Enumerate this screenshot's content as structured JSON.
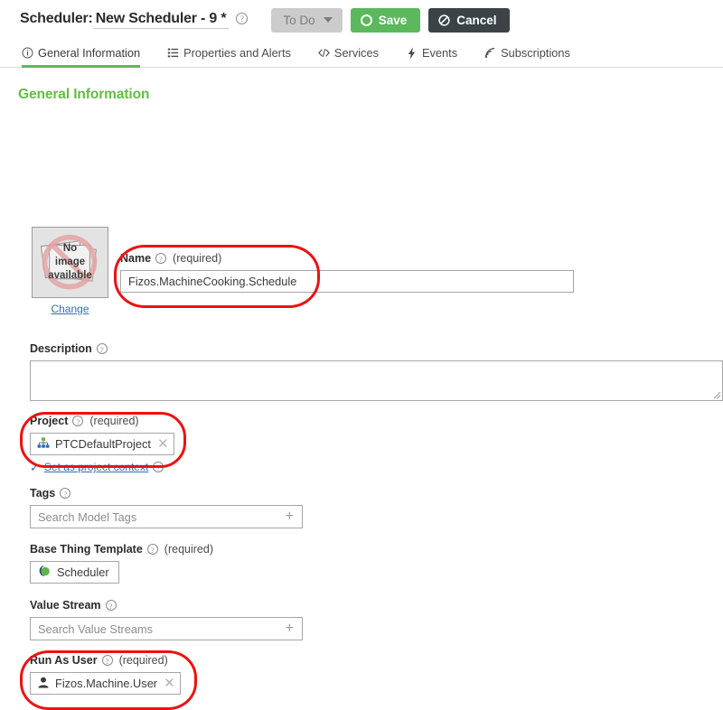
{
  "header": {
    "title_prefix": "Scheduler:",
    "title_name": "New Scheduler - 9 *",
    "help_glyph": "?",
    "status_button": "To Do",
    "save_button": "Save",
    "cancel_button": "Cancel",
    "save_color": "#5cb85c",
    "cancel_color": "#3b4346",
    "status_color": "#cccccc"
  },
  "tabs": [
    {
      "label": "General Information",
      "icon": "info-circle-icon",
      "active": true
    },
    {
      "label": "Properties and Alerts",
      "icon": "list-icon",
      "active": false
    },
    {
      "label": "Services",
      "icon": "code-icon",
      "active": false
    },
    {
      "label": "Events",
      "icon": "lightning-icon",
      "active": false
    },
    {
      "label": "Subscriptions",
      "icon": "rss-icon",
      "active": false
    }
  ],
  "section": {
    "title": "General Information",
    "title_color": "#64bc46"
  },
  "thumbnail": {
    "line1": "No",
    "line2": "image",
    "line3": "available",
    "change_link": "Change"
  },
  "fields": {
    "name": {
      "label": "Name",
      "required": "(required)",
      "value": "Fizos.MachineCooking.Schedule"
    },
    "description": {
      "label": "Description",
      "value": ""
    },
    "project": {
      "label": "Project",
      "required": "(required)",
      "value": "PTCDefaultProject",
      "remove_glyph": "✕",
      "set_context_link": "Set as project context",
      "check_glyph": "✓"
    },
    "tags": {
      "label": "Tags",
      "placeholder": "Search Model Tags",
      "add_glyph": "+"
    },
    "base_thing_template": {
      "label": "Base Thing Template",
      "required": "(required)",
      "value": "Scheduler"
    },
    "value_stream": {
      "label": "Value Stream",
      "placeholder": "Search Value Streams",
      "add_glyph": "+"
    },
    "run_as_user": {
      "label": "Run As User",
      "required": "(required)",
      "value": "Fizos.Machine.User",
      "remove_glyph": "✕"
    }
  },
  "annotations": {
    "color": "#ee1111",
    "highlighted": [
      "name",
      "project",
      "run_as_user"
    ]
  }
}
